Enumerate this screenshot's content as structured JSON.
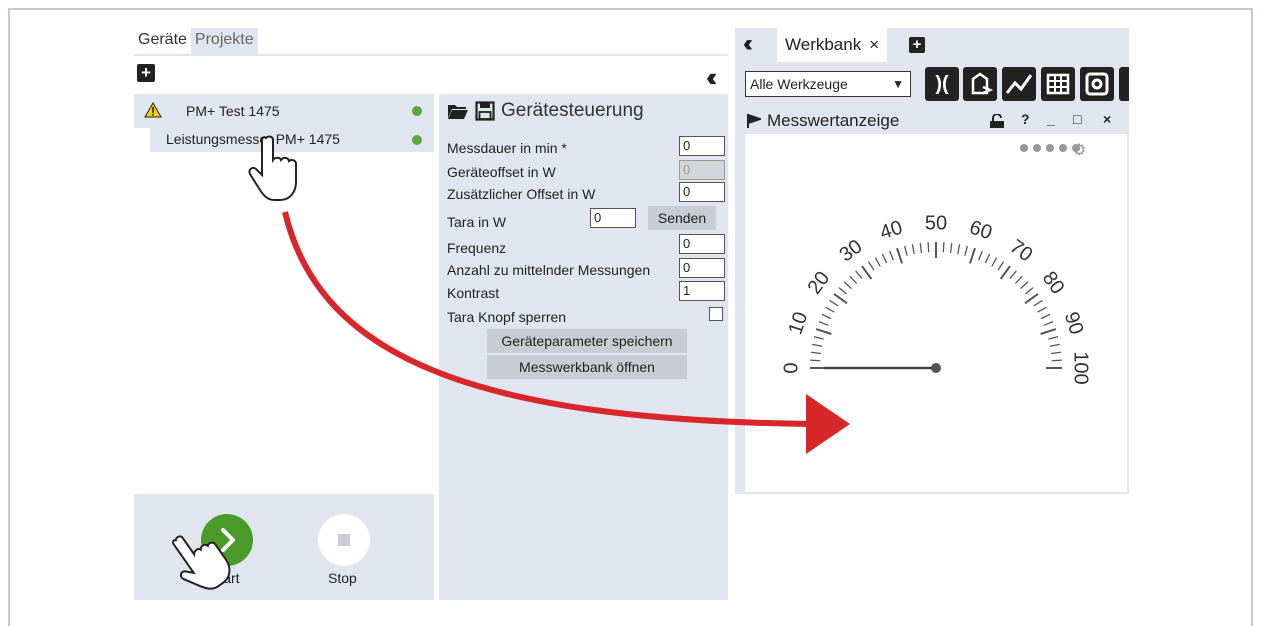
{
  "left_tabs": [
    {
      "label": "Geräte"
    },
    {
      "label": "Projekte"
    }
  ],
  "device_tree": {
    "device": {
      "label": "PM+ Test 1475",
      "status_color": "#5ba63b"
    },
    "child": {
      "label": "Leistungsmesser PM+ 1475",
      "status_color": "#5ba63b"
    }
  },
  "controls": {
    "start_label": "Start",
    "stop_label": "Stop",
    "start_color": "#4c9a2a"
  },
  "device_control": {
    "title": "Gerätesteuerung",
    "fields": [
      {
        "label": "Messdauer in min *",
        "value": "0"
      },
      {
        "label": "Geräteoffset in W",
        "value": "0"
      },
      {
        "label": "Zusätzlicher Offset in W",
        "value": "0"
      },
      {
        "label": "Tara in W",
        "value": "0"
      },
      {
        "label": "Frequenz",
        "value": "0"
      },
      {
        "label": "Anzahl zu mittelnder Messungen",
        "value": "0"
      },
      {
        "label": "Kontrast",
        "value": "1"
      },
      {
        "label": "Tara Knopf sperren",
        "value": ""
      }
    ],
    "send_label": "Senden",
    "save_params_label": "Geräteparameter speichern",
    "open_workbench_label": "Messwerkbank öffnen"
  },
  "workbench": {
    "tab_label": "Werkbank",
    "tab_close": "×",
    "tool_select": "Alle Werkzeuge",
    "panel_title": "Messwertanzeige",
    "panel_controls": [
      "?",
      "_",
      "□",
      "×"
    ],
    "gauge": {
      "min": 0,
      "max": 100,
      "value": 0,
      "labels": [
        "0",
        "10",
        "20",
        "30",
        "40",
        "50",
        "60",
        "70",
        "80",
        "90",
        "100"
      ]
    }
  },
  "colors": {
    "panel": "#e1e5ef",
    "arrow": "#d9262b",
    "status_ok": "#5ba63b"
  }
}
